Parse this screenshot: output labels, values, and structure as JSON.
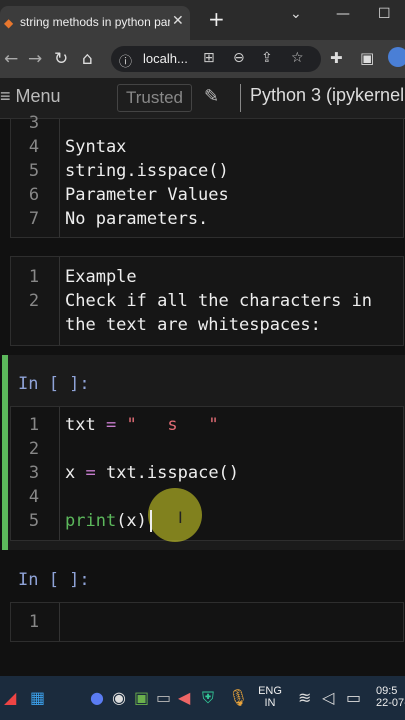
{
  "browser": {
    "tab_title": "string methods in python par",
    "url": "localh..."
  },
  "jupyter": {
    "menu_label": "Menu",
    "trusted_label": "Trusted",
    "kernel_name": "Python 3 (ipykernel"
  },
  "cells": {
    "md1": {
      "lines": [
        {
          "n": "3",
          "text": ""
        },
        {
          "n": "4",
          "text": "Syntax"
        },
        {
          "n": "5",
          "text": "string.isspace()"
        },
        {
          "n": "6",
          "text": "Parameter Values"
        },
        {
          "n": "7",
          "text": "No parameters."
        }
      ]
    },
    "md2": {
      "lines": [
        {
          "n": "1",
          "text": "Example"
        },
        {
          "n": "2",
          "text": "Check if all the characters in"
        },
        {
          "n": "",
          "text": "the text are whitespaces:"
        }
      ]
    },
    "code1": {
      "prompt": "In [ ]:",
      "lines": [
        {
          "n": "1",
          "a": "txt",
          "b": " = ",
          "c": "\"   s   \""
        },
        {
          "n": "2",
          "a": "",
          "b": "",
          "c": ""
        },
        {
          "n": "3",
          "a": "x",
          "b": " = ",
          "c": "txt.isspace()"
        },
        {
          "n": "4",
          "a": "",
          "b": "",
          "c": ""
        },
        {
          "n": "5",
          "a": "print",
          "b": "",
          "c": "(x)"
        }
      ]
    },
    "code2": {
      "prompt": "In [ ]:",
      "lines": [
        {
          "n": "1"
        }
      ]
    }
  },
  "taskbar": {
    "lang_top": "ENG",
    "lang_bottom": "IN",
    "time": "09:5",
    "date": "22-07-"
  },
  "colors": {
    "active_cell_border": "#5cb85c",
    "prompt": "#8fa3d8"
  }
}
